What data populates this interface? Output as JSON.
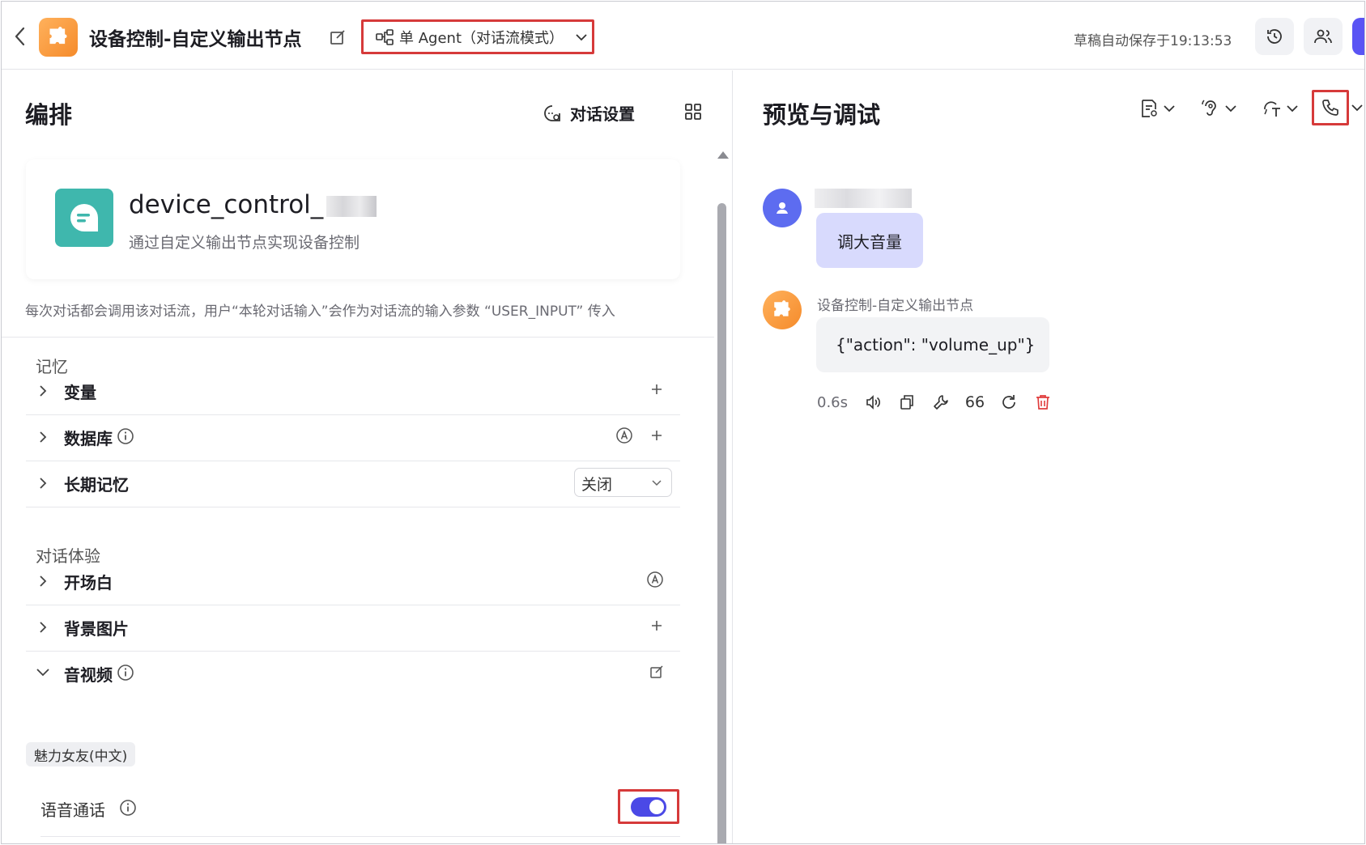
{
  "header": {
    "app_title": "设备控制-自定义输出节点",
    "mode_label": "单 Agent（对话流模式）",
    "autosave": "草稿自动保存于19:13:53"
  },
  "left": {
    "title": "编排",
    "dialog_settings": "对话设置",
    "bot": {
      "name": "device_control_",
      "description": "通过自定义输出节点实现设备控制"
    },
    "note": "每次对话都会调用该对话流，用户“本轮对话输入”会作为对话流的输入参数 “USER_INPUT” 传入",
    "memory_section": "记忆",
    "memory_items": [
      "变量",
      "数据库",
      "长期记忆"
    ],
    "long_memory_value": "关闭",
    "experience_section": "对话体验",
    "experience_items": [
      "开场白",
      "背景图片",
      "音视频"
    ],
    "voice_tag": "魅力女友(中文)",
    "voice_call_label": "语音通话",
    "voice_call_enabled": true
  },
  "right": {
    "title": "预览与调试",
    "user_message": "调大音量",
    "bot_name": "设备控制-自定义输出节点",
    "bot_message": "{\"action\": \"volume_up\"}",
    "latency": "0.6s",
    "quote_glyph": "66"
  },
  "colors": {
    "accent": "#4b49e6",
    "highlight_border": "#d63a3a",
    "user_bubble": "#d8dafd",
    "bot_card_icon": "#3fb7ad"
  }
}
